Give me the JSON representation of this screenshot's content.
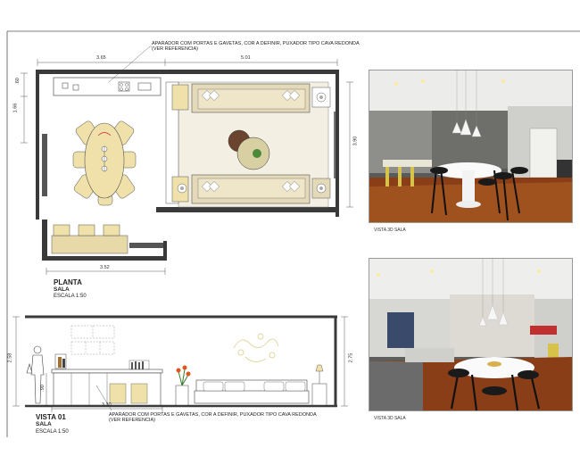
{
  "plan": {
    "title": "PLANTA",
    "room": "SALA",
    "scale": "ESCALA 1:50",
    "dims": {
      "top_left": "3.65",
      "top_right": "5.01",
      "left_top": ".60",
      "left_mid": "1.66",
      "right_mid": "3.90",
      "bottom": "3.52"
    },
    "note_line1": "APARADOR COM PORTAS E GAVETAS, COR A DEFINIR, PUXADOR TIPO CAVA REDONDA",
    "note_line2": "(VER REFERENCIA)"
  },
  "elevation": {
    "title": "VISTA 01",
    "room": "SALA",
    "scale": "ESCALA 1:50",
    "dims": {
      "left_height": "2.58",
      "right_height": "2.75",
      "cabinet_height": ".90",
      "bottom": "3.30"
    },
    "note_line1": "APARADOR COM PORTAS E GAVETAS, COR A DEFINIR, PUXADOR TIPO CAVA REDONDA",
    "note_line2": "(VER REFERENCIA)"
  },
  "renders": [
    {
      "caption": "VISTA 3D SALA"
    },
    {
      "caption": "VISTA 3D SALA"
    }
  ],
  "colors": {
    "wall": "#3a3a3a",
    "rug": "#f3efe3",
    "sofa": "#e4d9b8",
    "table": "#efe1a9",
    "wood": "#a0521e",
    "render_wall": "#8e8e8a"
  }
}
